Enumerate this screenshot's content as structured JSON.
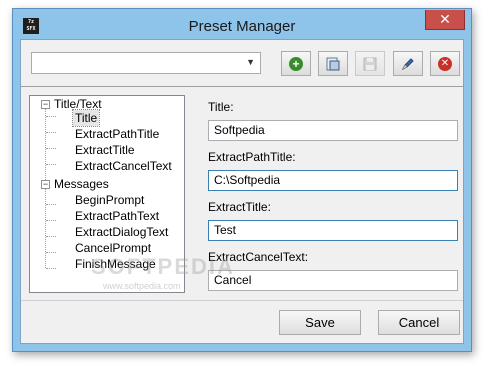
{
  "window": {
    "title": "Preset Manager",
    "app_icon_lines": [
      "7z",
      "SFX"
    ],
    "close_glyph": "✕"
  },
  "toolbar": {
    "preset_select": {
      "value": "",
      "arrow": "▼"
    },
    "buttons": [
      {
        "name": "add-preset-button",
        "icon": "plus-circle-icon",
        "glyph": "+",
        "color": "#3a8a2e",
        "enabled": true
      },
      {
        "name": "load-preset-button",
        "icon": "document-load-icon",
        "glyph": "",
        "color": "#5b7b9a",
        "enabled": true
      },
      {
        "name": "save-preset-button",
        "icon": "floppy-disk-icon",
        "glyph": "",
        "color": "#8a8a8a",
        "enabled": false
      },
      {
        "name": "edit-preset-button",
        "icon": "pencil-icon",
        "glyph": "",
        "color": "#3a6fb0",
        "enabled": true
      },
      {
        "name": "delete-preset-button",
        "icon": "delete-circle-icon",
        "glyph": "✕",
        "color": "#c8312b",
        "enabled": true
      }
    ]
  },
  "tree": {
    "groups": [
      {
        "label": "Title/Text",
        "expander": "−",
        "items": [
          "Title",
          "ExtractPathTitle",
          "ExtractTitle",
          "ExtractCancelText"
        ],
        "selected_index": 0
      },
      {
        "label": "Messages",
        "expander": "−",
        "items": [
          "BeginPrompt",
          "ExtractPathText",
          "ExtractDialogText",
          "CancelPrompt",
          "FinishMessage"
        ]
      }
    ]
  },
  "fields": [
    {
      "label": "Title:",
      "value": "Softpedia"
    },
    {
      "label": "ExtractPathTitle:",
      "value": "C:\\Softpedia"
    },
    {
      "label": "ExtractTitle:",
      "value": "Test"
    },
    {
      "label": "ExtractCancelText:",
      "value": "Cancel"
    }
  ],
  "footer": {
    "save_label": "Save",
    "cancel_label": "Cancel"
  },
  "watermark": {
    "text": "SOFTPEDIA",
    "url": "www.softpedia.com"
  }
}
